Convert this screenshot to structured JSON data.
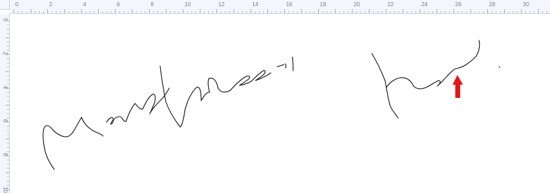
{
  "horizontal_ruler": {
    "labels": [
      "0",
      "2",
      "4",
      "6",
      "8",
      "10",
      "12",
      "14",
      "16",
      "18",
      "20",
      "22",
      "24",
      "26",
      "28",
      "30"
    ]
  },
  "vertical_ruler": {
    "labels": [
      "5",
      "2",
      "4",
      "6",
      "8",
      "10"
    ]
  },
  "colors": {
    "ruler_bg": "#f3f6fb",
    "ruler_border": "#c8d3e2",
    "ink": "#111111",
    "pointer_arrow": "#e5151a"
  },
  "icons": {
    "pointer": "red-up-arrow-icon"
  }
}
